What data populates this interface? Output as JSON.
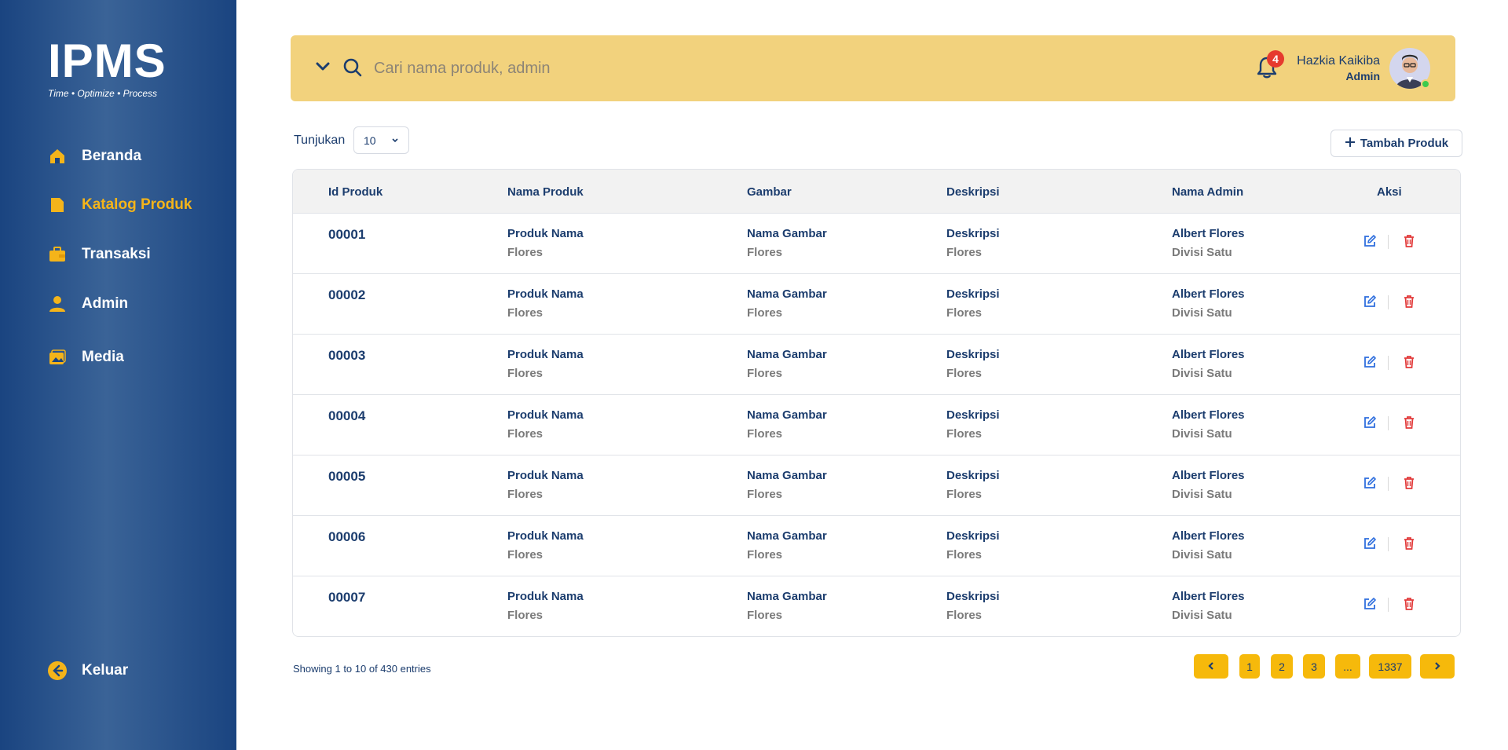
{
  "brand": {
    "logo_text": "IPMS",
    "tagline": "Time • Optimize  • Process"
  },
  "sidebar": {
    "items": [
      {
        "label": "Beranda",
        "icon": "home-icon"
      },
      {
        "label": "Katalog Produk",
        "icon": "catalog-icon",
        "active": true
      },
      {
        "label": "Transaksi",
        "icon": "briefcase-icon"
      },
      {
        "label": "Admin",
        "icon": "user-icon"
      },
      {
        "label": "Media",
        "icon": "media-icon"
      }
    ],
    "logout": {
      "label": "Keluar",
      "icon": "logout-icon"
    }
  },
  "topbar": {
    "search_placeholder": "Cari nama produk, admin",
    "notification_count": "4",
    "user_name": "Hazkia Kaikiba",
    "user_role": "Admin"
  },
  "controls": {
    "show_label": "Tunjukan",
    "show_value": "10",
    "add_button_label": "Tambah Produk"
  },
  "table": {
    "headers": [
      "Id Produk",
      "Nama Produk",
      "Gambar",
      "Deskripsi",
      "Nama Admin",
      "Aksi"
    ],
    "rows": [
      {
        "id": "00001",
        "name": "Produk Nama",
        "name_sub": "Flores",
        "image": "Nama Gambar",
        "image_sub": "Flores",
        "desc": "Deskripsi",
        "desc_sub": "Flores",
        "admin": "Albert Flores",
        "admin_sub": "Divisi  Satu"
      },
      {
        "id": "00002",
        "name": "Produk Nama",
        "name_sub": "Flores",
        "image": "Nama Gambar",
        "image_sub": "Flores",
        "desc": "Deskripsi",
        "desc_sub": "Flores",
        "admin": "Albert Flores",
        "admin_sub": "Divisi  Satu"
      },
      {
        "id": "00003",
        "name": "Produk Nama",
        "name_sub": "Flores",
        "image": "Nama Gambar",
        "image_sub": "Flores",
        "desc": "Deskripsi",
        "desc_sub": "Flores",
        "admin": "Albert Flores",
        "admin_sub": "Divisi  Satu"
      },
      {
        "id": "00004",
        "name": "Produk Nama",
        "name_sub": "Flores",
        "image": "Nama Gambar",
        "image_sub": "Flores",
        "desc": "Deskripsi",
        "desc_sub": "Flores",
        "admin": "Albert Flores",
        "admin_sub": "Divisi  Satu"
      },
      {
        "id": "00005",
        "name": "Produk Nama",
        "name_sub": "Flores",
        "image": "Nama Gambar",
        "image_sub": "Flores",
        "desc": "Deskripsi",
        "desc_sub": "Flores",
        "admin": "Albert Flores",
        "admin_sub": "Divisi  Satu"
      },
      {
        "id": "00006",
        "name": "Produk Nama",
        "name_sub": "Flores",
        "image": "Nama Gambar",
        "image_sub": "Flores",
        "desc": "Deskripsi",
        "desc_sub": "Flores",
        "admin": "Albert Flores",
        "admin_sub": "Divisi  Satu"
      },
      {
        "id": "00007",
        "name": "Produk Nama",
        "name_sub": "Flores",
        "image": "Nama Gambar",
        "image_sub": "Flores",
        "desc": "Deskripsi",
        "desc_sub": "Flores",
        "admin": "Albert Flores",
        "admin_sub": "Divisi  Satu"
      }
    ]
  },
  "footer": {
    "entries_text": "Showing 1 to 10 of 430 entries",
    "pages": [
      "1",
      "2",
      "3",
      "...",
      "1337"
    ]
  },
  "colors": {
    "sidebar": "#1a4480",
    "accent": "#f4b41a",
    "topbar": "#f2d27d",
    "text": "#1c3d6e",
    "edit": "#2f6fde",
    "delete": "#e23b3b"
  }
}
